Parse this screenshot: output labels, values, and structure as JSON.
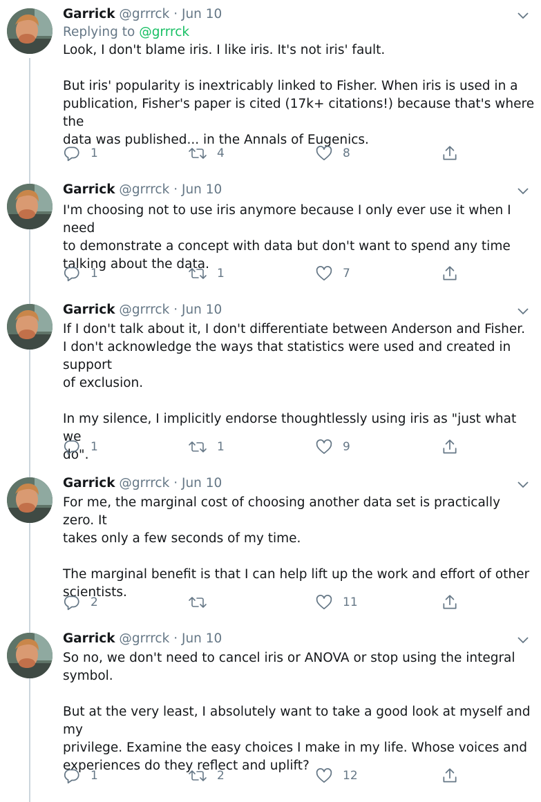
{
  "tweets": [
    {
      "name": "Garrick",
      "handle": "@grrrck",
      "separator": "·",
      "date": "Jun 10",
      "replying_to_label": "Replying to ",
      "replying_to_handle": "@grrrck",
      "paragraphs": [
        "Look, I don't blame iris. I like iris. It's not iris' fault.",
        "But iris' popularity is inextricably linked to Fisher. When iris is used in a\npublication, Fisher's paper is cited (17k+ citations!) because that's where the\ndata was published... in the Annals of Eugenics."
      ],
      "replies": "1",
      "retweets": "4",
      "likes": "8"
    },
    {
      "name": "Garrick",
      "handle": "@grrrck",
      "separator": "·",
      "date": "Jun 10",
      "paragraphs": [
        "I'm choosing not to use iris anymore because I only ever use it when I need\nto demonstrate a concept with data but don't want to spend any time\ntalking about the data."
      ],
      "replies": "1",
      "retweets": "1",
      "likes": "7"
    },
    {
      "name": "Garrick",
      "handle": "@grrrck",
      "separator": "·",
      "date": "Jun 10",
      "paragraphs": [
        "If I don't talk about it, I don't differentiate between Anderson and Fisher.\nI don't acknowledge the ways that statistics were used and created in support\nof exclusion.",
        "In my silence, I implicitly endorse thoughtlessly using iris as \"just what we\ndo\"."
      ],
      "replies": "1",
      "retweets": "1",
      "likes": "9"
    },
    {
      "name": "Garrick",
      "handle": "@grrrck",
      "separator": "·",
      "date": "Jun 10",
      "paragraphs": [
        "For me, the marginal cost of choosing another data set is practically zero. It\ntakes only a few seconds of my time.",
        "The marginal benefit is that I can help lift up the work and effort of other\nscientists."
      ],
      "replies": "2",
      "retweets": "",
      "likes": "11"
    },
    {
      "name": "Garrick",
      "handle": "@grrrck",
      "separator": "·",
      "date": "Jun 10",
      "paragraphs": [
        "So no, we don't need to cancel iris or ANOVA or stop using the integral\nsymbol.",
        "But at the very least, I absolutely want to take a good look at myself and my\nprivilege. Examine the easy choices I make in my life. Whose voices and\nexperiences do they reflect and uplift?"
      ],
      "replies": "1",
      "retweets": "2",
      "likes": "12"
    }
  ],
  "icons": {
    "avatar": "avatar-photo",
    "caret": "chevron-down-icon",
    "reply": "reply-icon",
    "retweet": "retweet-icon",
    "like": "heart-icon",
    "share": "share-icon"
  },
  "colors": {
    "text": "#14171a",
    "secondary": "#657786",
    "mention": "#17bf63",
    "thread_line": "#ccd6dd"
  }
}
